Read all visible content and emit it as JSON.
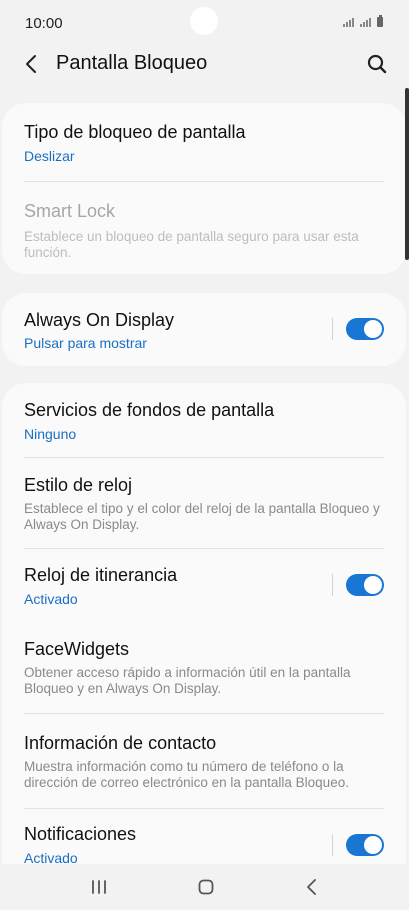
{
  "status": {
    "time": "10:00"
  },
  "header": {
    "title": "Pantalla Bloqueo"
  },
  "cards": [
    {
      "items": [
        {
          "title": "Tipo de bloqueo de pantalla",
          "subtitle": "Deslizar"
        },
        {
          "title": "Smart Lock",
          "description": "Establece un bloqueo de pantalla seguro para usar esta función.",
          "disabled": true
        }
      ]
    },
    {
      "items": [
        {
          "title": "Always On Display",
          "subtitle": "Pulsar para mostrar",
          "toggle": true
        }
      ]
    },
    {
      "items": [
        {
          "title": "Servicios de fondos de pantalla",
          "subtitle": "Ninguno"
        },
        {
          "title": "Estilo de reloj",
          "description": "Establece el tipo y el color del reloj de la pantalla Bloqueo y Always On Display."
        },
        {
          "title": "Reloj de itinerancia",
          "subtitle": "Activado",
          "toggle": true
        },
        {
          "title": "FaceWidgets",
          "description": "Obtener acceso rápido a información útil en la pantalla Bloqueo y en Always On Display."
        },
        {
          "title": "Información de contacto",
          "description": "Muestra información como tu número de teléfono o la dirección de correo electrónico en la pantalla Bloqueo."
        },
        {
          "title": "Notificaciones",
          "subtitle": "Activado",
          "toggle": true
        }
      ]
    }
  ],
  "colors": {
    "accent": "#1976d2",
    "link": "#1a6fc4",
    "background": "#f2f2f2",
    "card": "#fafafa"
  },
  "icons": {
    "back": "chevron-left-icon",
    "search": "search-icon",
    "recents": "recents-icon",
    "home": "home-icon",
    "nav_back": "nav-back-icon"
  }
}
